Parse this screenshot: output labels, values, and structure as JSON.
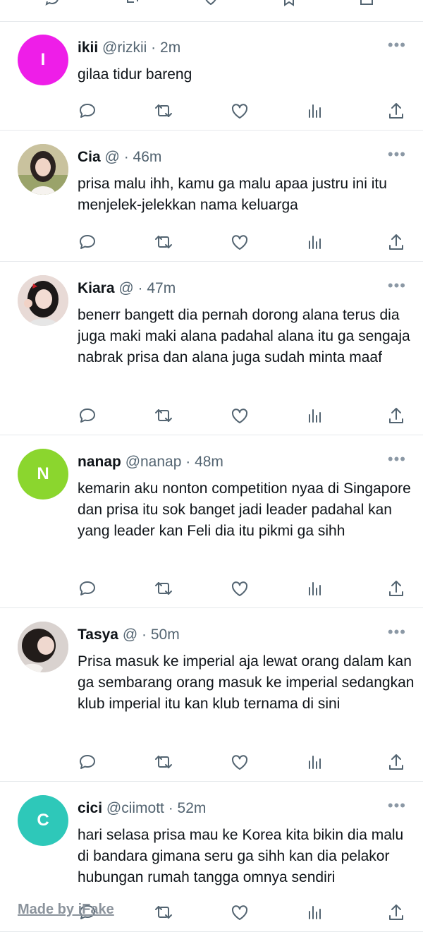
{
  "tweets": [
    {
      "name": "ikii",
      "handle": "@rizkii",
      "time": "2m",
      "initial": "I",
      "avatar_color": "#ee1ee8",
      "text": "gilaa tidur bareng"
    },
    {
      "name": "Cia",
      "handle": "@",
      "time": "46m",
      "initial": "",
      "avatar_color": "#d8d2b7",
      "text": "prisa malu ihh, kamu ga malu apaa justru ini itu menjelek-jelekkan nama keluarga"
    },
    {
      "name": "Kiara",
      "handle": "@",
      "time": "47m",
      "initial": "",
      "avatar_color": "#e9dcd8",
      "text": "benerr bangett dia pernah dorong alana terus dia juga maki maki alana padahal alana itu ga sengaja nabrak prisa dan alana juga sudah minta maaf"
    },
    {
      "name": "nanap",
      "handle": "@nanap",
      "time": "48m",
      "initial": "N",
      "avatar_color": "#8bd62e",
      "text": "kemarin aku nonton competition nyaa di Singapore dan prisa itu sok banget jadi leader padahal kan yang leader kan Feli dia itu pikmi ga sihh"
    },
    {
      "name": "Tasya",
      "handle": "@",
      "time": "50m",
      "initial": "",
      "avatar_color": "#cfc7c4",
      "text": "Prisa masuk ke imperial aja lewat orang dalam kan ga sembarang orang masuk ke imperial sedangkan klub imperial itu kan klub ternama di sini"
    },
    {
      "name": "cici",
      "handle": "@ciimott",
      "time": "52m",
      "initial": "C",
      "avatar_color": "#2ec8b9",
      "text": "hari selasa prisa mau ke Korea kita bikin dia malu di bandara gimana seru ga sihh kan dia pelakor hubungan rumah tangga omnya sendiri"
    }
  ],
  "separator": "·",
  "more_glyph": "•••",
  "watermark": "Made by iFake",
  "icons": [
    "reply-icon",
    "retweet-icon",
    "like-icon",
    "views-icon",
    "share-icon"
  ]
}
